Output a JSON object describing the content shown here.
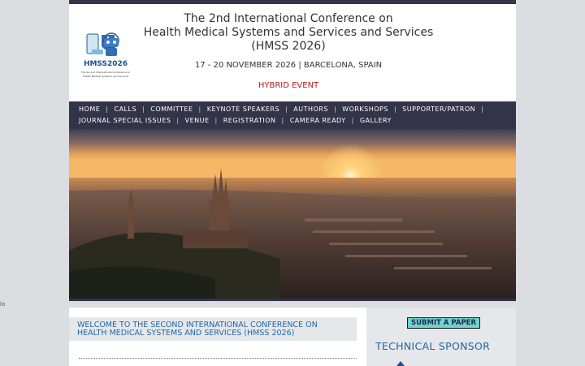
{
  "stray_text": "lo",
  "logo": {
    "text": "HMSS2026",
    "subtext": "The Second International Conference on Health Medical Systems and Services"
  },
  "header": {
    "title_line1": "The 2nd International Conference on",
    "title_line2": "Health Medical Systems and Services and Services",
    "title_line3": "(HMSS 2026)",
    "dates": "17 - 20 NOVEMBER 2026 | BARCELONA, SPAIN",
    "event_type": "HYBRID EVENT"
  },
  "nav": {
    "row1": [
      "HOME",
      "CALLS",
      "COMMITTEE",
      "KEYNOTE SPEAKERS",
      "AUTHORS",
      "WORKSHOPS",
      "SUPPORTER/PATRON"
    ],
    "row2": [
      "JOURNAL SPECIAL ISSUES",
      "VENUE",
      "REGISTRATION",
      "CAMERA READY",
      "GALLERY"
    ],
    "separator": "|"
  },
  "main": {
    "welcome": "WELCOME TO THE SECOND INTERNATIONAL CONFERENCE ON HEALTH MEDICAL SYSTEMS AND SERVICES (HMSS 2026)"
  },
  "sidebar": {
    "submit_label": "SUBMIT A PAPER",
    "technical_sponsor": "TECHNICAL SPONSOR"
  },
  "colors": {
    "nav_bg": "#33334a",
    "accent_blue": "#1f67a3",
    "hybrid_red": "#b31b1b",
    "submit_bg": "#6fd3c8"
  }
}
